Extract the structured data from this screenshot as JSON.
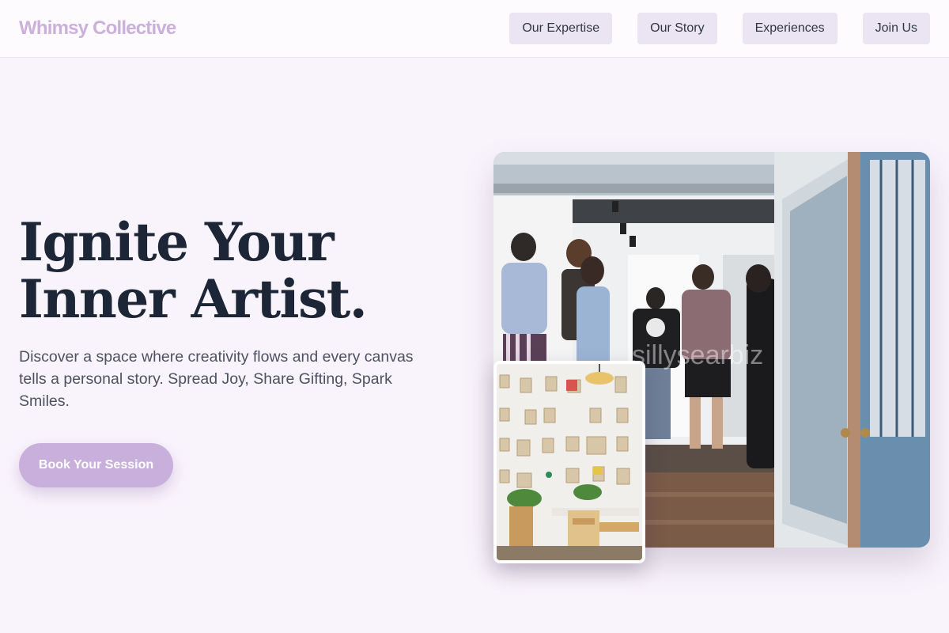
{
  "brand": {
    "name": "Whimsy Collective"
  },
  "nav": {
    "items": [
      {
        "label": "Our Expertise"
      },
      {
        "label": "Our Story"
      },
      {
        "label": "Experiences"
      },
      {
        "label": "Join Us"
      }
    ]
  },
  "hero": {
    "title_line1": "Ignite Your",
    "title_line2": "Inner Artist.",
    "description": "Discover a space where creativity flows and every canvas tells a personal story. Spread Joy, Share Gifting, Spark Smiles.",
    "cta_label": "Book Your Session"
  },
  "images": {
    "main_watermark": "sillysearbiz"
  },
  "colors": {
    "accent": "#c9b0dc",
    "background": "#f9f4fc",
    "nav_button": "#ebe5f3",
    "heading": "#1c2636"
  }
}
